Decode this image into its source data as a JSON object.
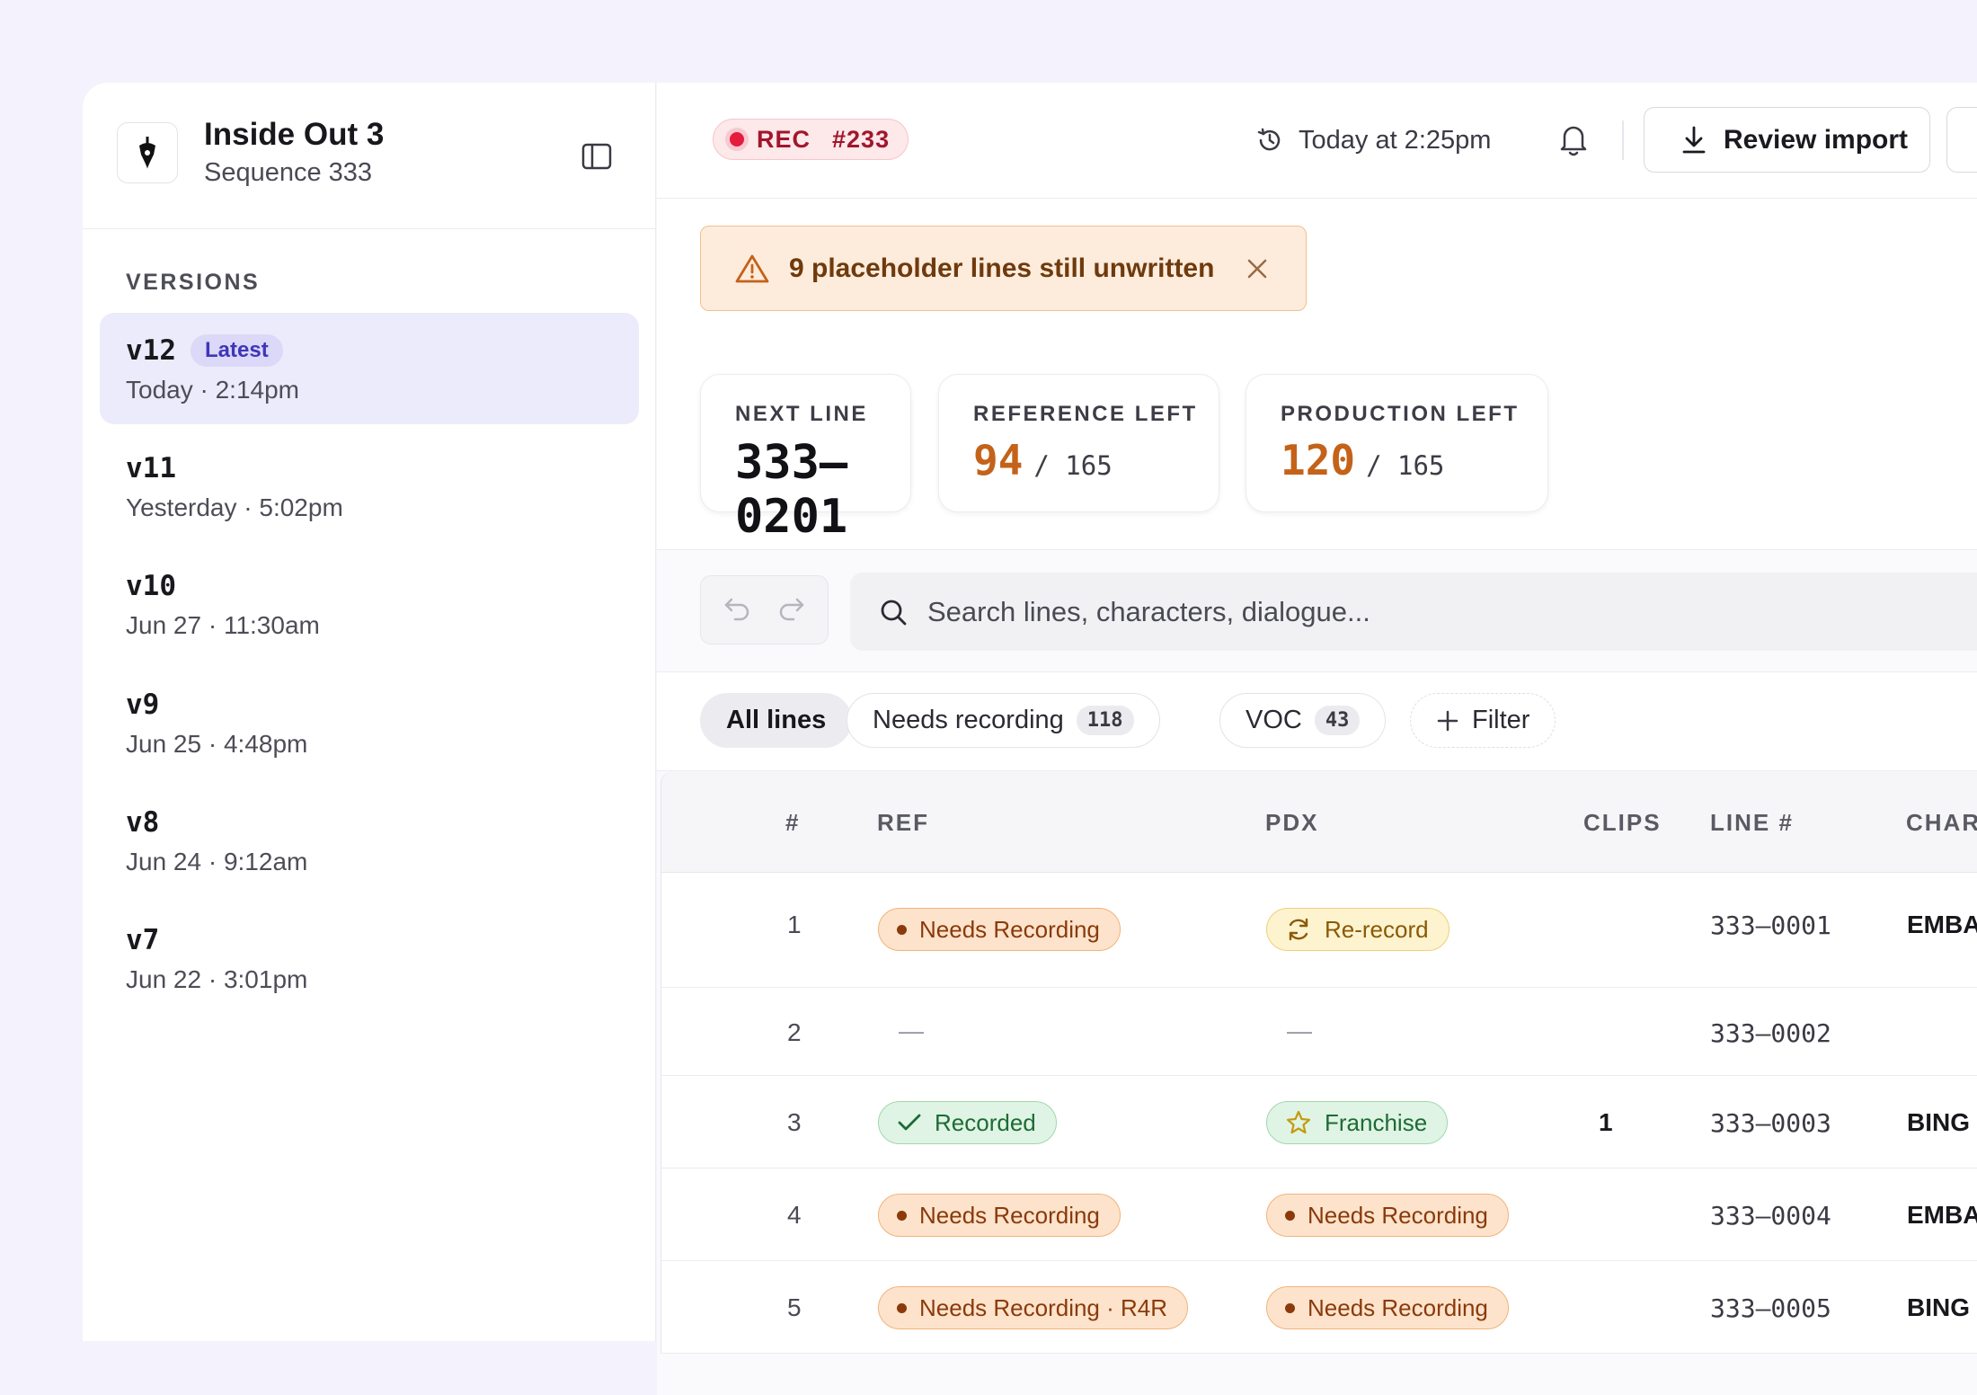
{
  "project": {
    "title": "Inside Out 3",
    "subtitle": "Sequence 333"
  },
  "sidebar": {
    "versions_heading": "VERSIONS",
    "versions": [
      {
        "name": "v12",
        "badge": "Latest",
        "time": "Today · 2:14pm",
        "active": true
      },
      {
        "name": "v11",
        "time": "Yesterday · 5:02pm"
      },
      {
        "name": "v10",
        "time": "Jun 27 · 11:30am"
      },
      {
        "name": "v9",
        "time": "Jun 25 · 4:48pm"
      },
      {
        "name": "v8",
        "time": "Jun 24 · 9:12am"
      },
      {
        "name": "v7",
        "time": "Jun 22 · 3:01pm"
      }
    ]
  },
  "topbar": {
    "rec_label": "REC",
    "rec_number": "#233",
    "saved_time": "Today at 2:25pm",
    "review_button": "Review import"
  },
  "alert": {
    "text": "9 placeholder lines still unwritten"
  },
  "stats": {
    "next_line_label": "NEXT LINE",
    "next_line_value": "333–0201",
    "reference_label": "REFERENCE LEFT",
    "reference_value": "94",
    "reference_total": "/ 165",
    "production_label": "PRODUCTION LEFT",
    "production_value": "120",
    "production_total": "/ 165"
  },
  "search": {
    "placeholder": "Search lines, characters, dialogue..."
  },
  "filters": {
    "all": "All lines",
    "needs_recording": "Needs recording",
    "needs_recording_count": "118",
    "voc": "VOC",
    "voc_count": "43",
    "add_filter": "Filter"
  },
  "table": {
    "headers": {
      "num": "#",
      "ref": "REF",
      "pdx": "PDX",
      "clips": "CLIPS",
      "line": "LINE #",
      "char": "CHAR"
    },
    "rows": [
      {
        "num": "1",
        "ref": "Needs Recording",
        "pdx": "Re-record",
        "clips": "",
        "line": "333–0001",
        "char": "EMBA"
      },
      {
        "num": "2",
        "ref": "—",
        "pdx": "—",
        "clips": "",
        "line": "333–0002",
        "char": ""
      },
      {
        "num": "3",
        "ref": "Recorded",
        "pdx": "Franchise",
        "clips": "1",
        "line": "333–0003",
        "char": "BING"
      },
      {
        "num": "4",
        "ref": "Needs Recording",
        "pdx": "Needs Recording",
        "clips": "",
        "line": "333–0004",
        "char": "EMBA"
      },
      {
        "num": "5",
        "ref": "Needs Recording · R4R",
        "pdx": "Needs Recording",
        "clips": "",
        "line": "333–0005",
        "char": "BING"
      }
    ]
  }
}
